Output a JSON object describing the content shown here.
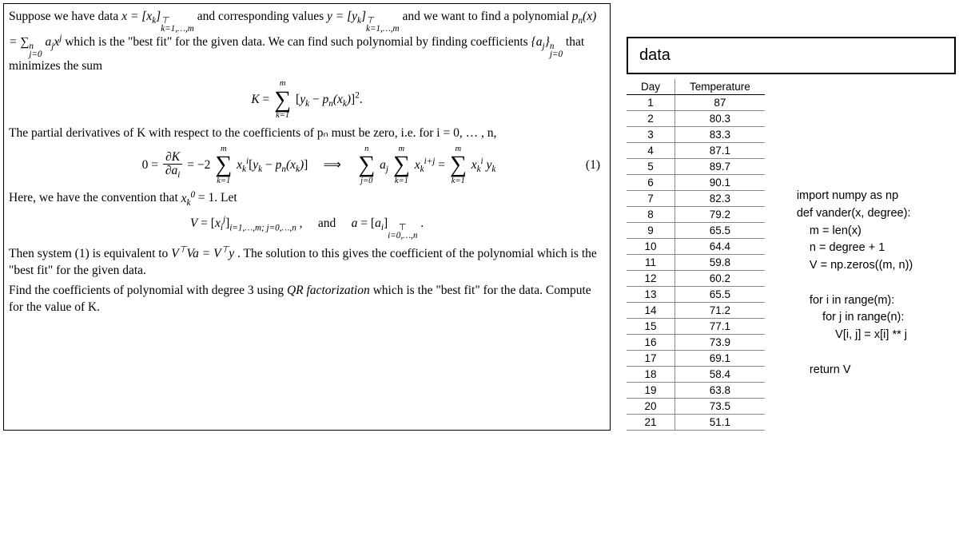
{
  "problem": {
    "para1_a": "Suppose we have data ",
    "para1_b": " and corresponding values ",
    "para1_c": " and we want to find a polynomial ",
    "para1_d": " which is the \"best fit\" for the given data. We can find such polynomial by finding coefficients ",
    "para1_e": " that minimizes the sum",
    "para2": "The partial derivatives of K with respect to the coefficients of pₙ must be zero, i.e. for i = 0, … , n,",
    "eq1_num": "(1)",
    "para3_a": "Here, we have the convention that ",
    "para3_b": " = 1. Let",
    "and": "and",
    "para4_a": "Then system (1) is equivalent to ",
    "para4_b": ". The solution to this gives the coefficient of the polynomial which is the \"best fit\" for the given data.",
    "para5_a": "Find the coefficients of polynomial with degree 3 using ",
    "para5_qr": "QR factorization",
    "para5_b": " which is the \"best fit\" for the data. Compute for the value of K."
  },
  "data_title": "data",
  "table": {
    "headers": [
      "Day",
      "Temperature"
    ],
    "rows": [
      [
        "1",
        "87"
      ],
      [
        "2",
        "80.3"
      ],
      [
        "3",
        "83.3"
      ],
      [
        "4",
        "87.1"
      ],
      [
        "5",
        "89.7"
      ],
      [
        "6",
        "90.1"
      ],
      [
        "7",
        "82.3"
      ],
      [
        "8",
        "79.2"
      ],
      [
        "9",
        "65.5"
      ],
      [
        "10",
        "64.4"
      ],
      [
        "11",
        "59.8"
      ],
      [
        "12",
        "60.2"
      ],
      [
        "13",
        "65.5"
      ],
      [
        "14",
        "71.2"
      ],
      [
        "15",
        "77.1"
      ],
      [
        "16",
        "73.9"
      ],
      [
        "17",
        "69.1"
      ],
      [
        "18",
        "58.4"
      ],
      [
        "19",
        "63.8"
      ],
      [
        "20",
        "73.5"
      ],
      [
        "21",
        "51.1"
      ]
    ]
  },
  "code": {
    "l1": "import numpy as np",
    "l2": "def vander(x, degree):",
    "l3": "    m = len(x)",
    "l4": "    n = degree + 1",
    "l5": "    V = np.zeros((m, n))",
    "l6": "",
    "l7": "    for i in range(m):",
    "l8": "        for j in range(n):",
    "l9": "            V[i, j] = x[i] ** j",
    "l10": "",
    "l11": "    return V"
  }
}
